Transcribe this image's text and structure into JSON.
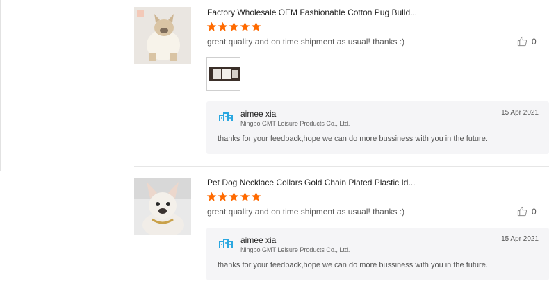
{
  "colors": {
    "star": "#ff6a00",
    "reply_bg": "#f5f5f7",
    "supplier_logo": "#2aa7e0",
    "divider": "#e6e6e6"
  },
  "reviews": [
    {
      "product_title": "Factory Wholesale OEM Fashionable Cotton Pug Bulld...",
      "rating": 5,
      "comment": "great quality and on time shipment as usual! thanks :)",
      "likes": "0",
      "has_attachment": true,
      "reply": {
        "name": "aimee xia",
        "company": "Ningbo GMT Leisure Products Co., Ltd.",
        "date": "15 Apr 2021",
        "text": "thanks for your feedback,hope we can do more bussiness with you in the future."
      }
    },
    {
      "product_title": "Pet Dog Necklace Collars Gold Chain Plated Plastic Id...",
      "rating": 5,
      "comment": "great quality and on time shipment as usual! thanks :)",
      "likes": "0",
      "has_attachment": false,
      "reply": {
        "name": "aimee xia",
        "company": "Ningbo GMT Leisure Products Co., Ltd.",
        "date": "15 Apr 2021",
        "text": "thanks for your feedback,hope we can do more bussiness with you in the future."
      }
    }
  ]
}
